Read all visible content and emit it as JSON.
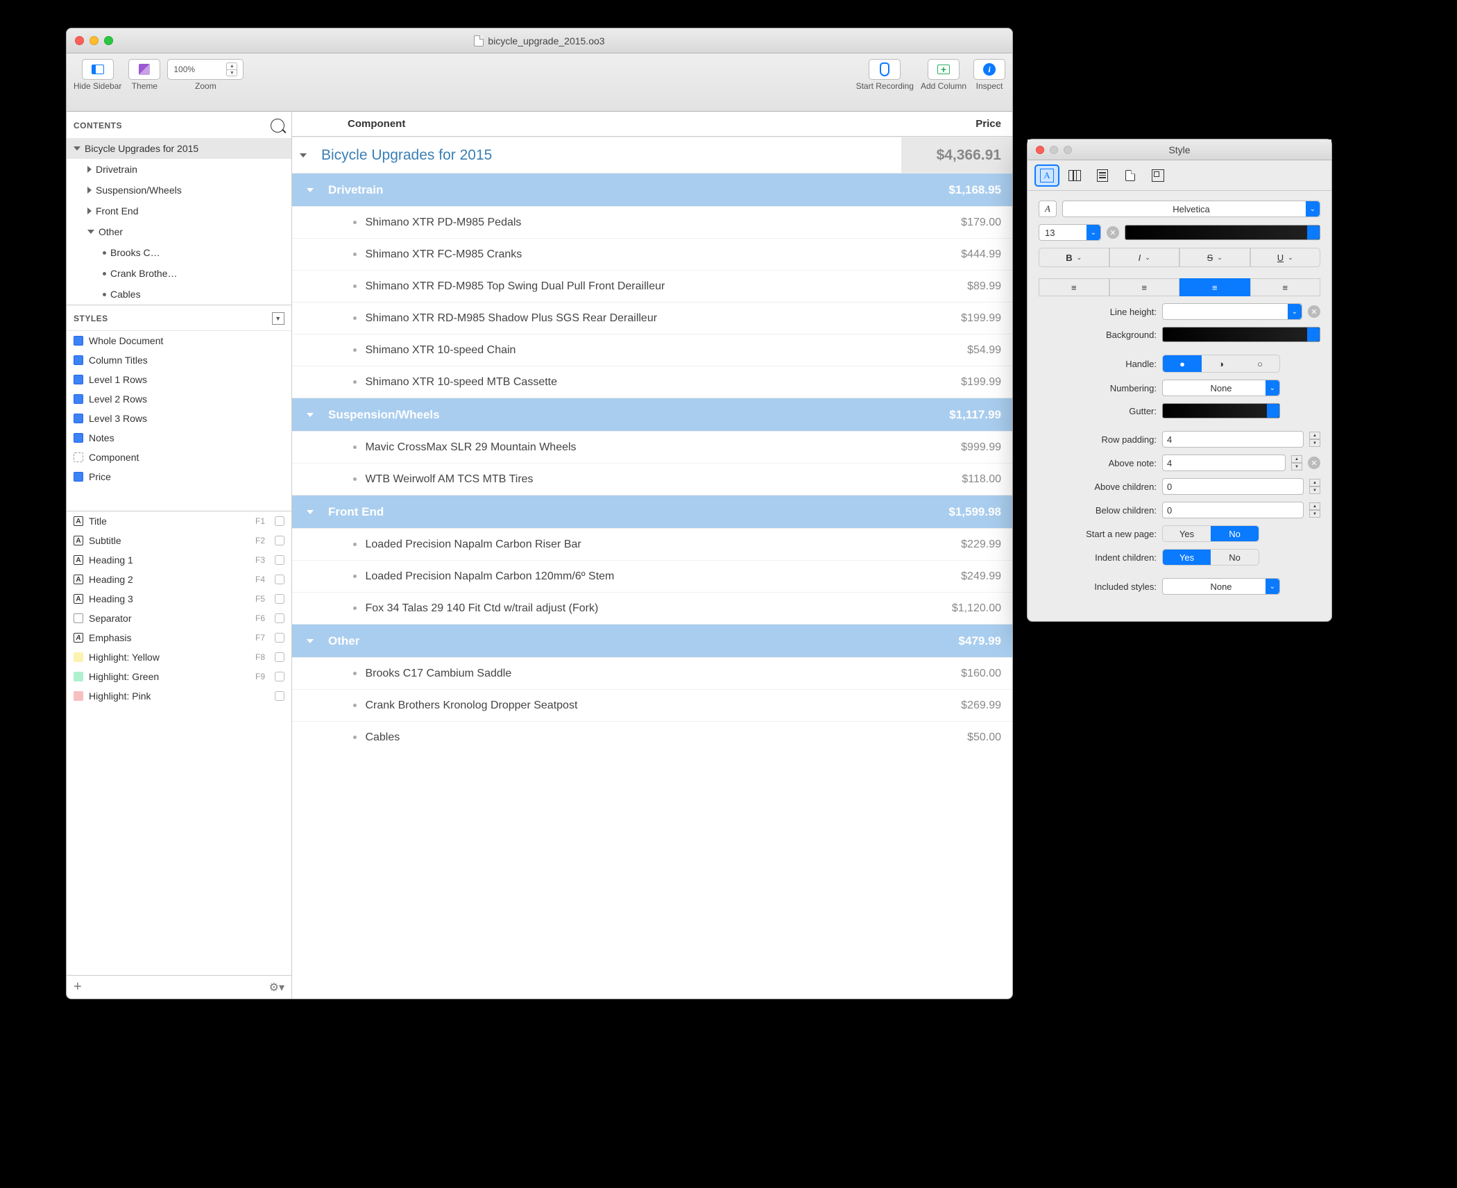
{
  "window": {
    "filename": "bicycle_upgrade_2015.oo3"
  },
  "toolbar": {
    "hide_sidebar": "Hide Sidebar",
    "theme": "Theme",
    "zoom_label": "Zoom",
    "zoom_value": "100%",
    "start_recording": "Start Recording",
    "add_column": "Add Column",
    "inspect": "Inspect"
  },
  "sidebar": {
    "contents_label": "CONTENTS",
    "styles_label": "STYLES",
    "tree": {
      "root": "Bicycle Upgrades for 2015",
      "children": [
        {
          "label": "Drivetrain"
        },
        {
          "label": "Suspension/Wheels"
        },
        {
          "label": "Front End"
        },
        {
          "label": "Other",
          "expanded": true,
          "children": [
            {
              "label": "Brooks C…"
            },
            {
              "label": "Crank Brothe…"
            },
            {
              "label": "Cables"
            }
          ]
        }
      ]
    },
    "styles_top": [
      "Whole Document",
      "Column Titles",
      "Level 1 Rows",
      "Level 2 Rows",
      "Level 3 Rows",
      "Notes",
      "Component",
      "Price"
    ],
    "styles_bottom": [
      {
        "label": "Title",
        "key": "F1"
      },
      {
        "label": "Subtitle",
        "key": "F2"
      },
      {
        "label": "Heading 1",
        "key": "F3"
      },
      {
        "label": "Heading 2",
        "key": "F4"
      },
      {
        "label": "Heading 3",
        "key": "F5"
      },
      {
        "label": "Separator",
        "key": "F6"
      },
      {
        "label": "Emphasis",
        "key": "F7"
      },
      {
        "label": "Highlight: Yellow",
        "key": "F8"
      },
      {
        "label": "Highlight: Green",
        "key": "F9"
      },
      {
        "label": "Highlight: Pink",
        "key": ""
      }
    ]
  },
  "columns": {
    "c1": "Component",
    "c2": "Price"
  },
  "outline": {
    "title": {
      "label": "Bicycle Upgrades for 2015",
      "price": "$4,366.91"
    },
    "sections": [
      {
        "label": "Drivetrain",
        "price": "$1,168.95",
        "items": [
          {
            "label": "Shimano XTR PD-M985 Pedals",
            "price": "$179.00"
          },
          {
            "label": "Shimano XTR FC-M985 Cranks",
            "price": "$444.99"
          },
          {
            "label": "Shimano XTR FD-M985 Top Swing Dual Pull Front Derailleur",
            "price": "$89.99"
          },
          {
            "label": "Shimano XTR RD-M985 Shadow Plus SGS Rear Derailleur",
            "price": "$199.99"
          },
          {
            "label": "Shimano XTR 10-speed Chain",
            "price": "$54.99"
          },
          {
            "label": "Shimano XTR 10-speed MTB Cassette",
            "price": "$199.99"
          }
        ]
      },
      {
        "label": "Suspension/Wheels",
        "price": "$1,117.99",
        "items": [
          {
            "label": "Mavic CrossMax SLR 29 Mountain Wheels",
            "price": "$999.99"
          },
          {
            "label": "WTB Weirwolf AM TCS MTB Tires",
            "price": "$118.00"
          }
        ]
      },
      {
        "label": "Front End",
        "price": "$1,599.98",
        "items": [
          {
            "label": "Loaded Precision Napalm Carbon Riser Bar",
            "price": "$229.99"
          },
          {
            "label": "Loaded Precision Napalm Carbon 120mm/6º Stem",
            "price": "$249.99"
          },
          {
            "label": "Fox 34 Talas 29 140 Fit Ctd w/trail adjust (Fork)",
            "price": "$1,120.00"
          }
        ]
      },
      {
        "label": "Other",
        "price": "$479.99",
        "items": [
          {
            "label": "Brooks C17 Cambium Saddle",
            "price": "$160.00"
          },
          {
            "label": "Crank Brothers Kronolog Dropper Seatpost",
            "price": "$269.99"
          },
          {
            "label": "Cables",
            "price": "$50.00"
          }
        ]
      }
    ]
  },
  "inspector": {
    "title": "Style",
    "font_family": "Helvetica",
    "font_size": "13",
    "labels": {
      "line_height": "Line height:",
      "background": "Background:",
      "handle": "Handle:",
      "numbering": "Numbering:",
      "gutter": "Gutter:",
      "row_padding": "Row padding:",
      "above_note": "Above note:",
      "above_children": "Above children:",
      "below_children": "Below children:",
      "new_page": "Start a new page:",
      "indent_children": "Indent children:",
      "included_styles": "Included styles:"
    },
    "values": {
      "numbering": "None",
      "row_padding": "4",
      "above_note": "4",
      "above_children": "0",
      "below_children": "0",
      "new_page": "No",
      "indent_children": "Yes",
      "included_styles": "None",
      "yes": "Yes",
      "no": "No"
    }
  }
}
